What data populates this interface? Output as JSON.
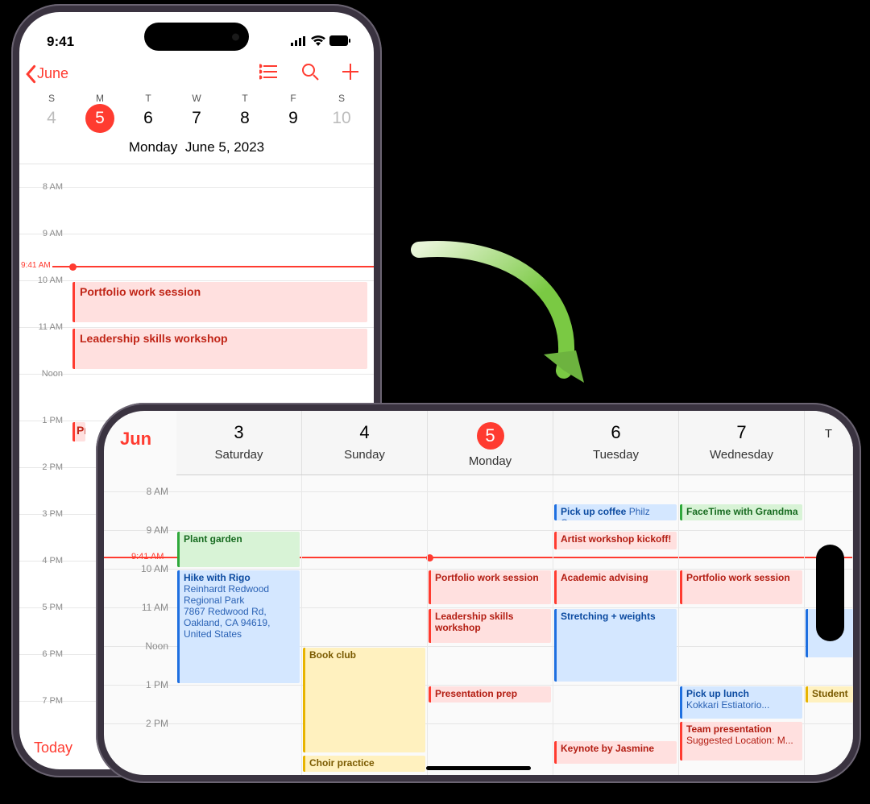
{
  "status": {
    "time": "9:41"
  },
  "portrait": {
    "back_label": "June",
    "dows": [
      "S",
      "M",
      "T",
      "W",
      "T",
      "F",
      "S"
    ],
    "days": [
      "4",
      "5",
      "6",
      "7",
      "8",
      "9",
      "10"
    ],
    "today_index": 1,
    "full_date_day": "Monday",
    "full_date": "June 5, 2023",
    "hours": [
      "8 AM",
      "9 AM",
      "10 AM",
      "11 AM",
      "Noon",
      "1 PM",
      "2 PM",
      "3 PM",
      "4 PM",
      "5 PM",
      "6 PM",
      "7 PM"
    ],
    "now_label": "9:41 AM",
    "events": {
      "e1": "Portfolio work session",
      "e2": "Leadership skills workshop",
      "e3": "Pr"
    },
    "today_button": "Today"
  },
  "landscape": {
    "month": "Jun",
    "cols": [
      {
        "num": "3",
        "name": "Saturday"
      },
      {
        "num": "4",
        "name": "Sunday"
      },
      {
        "num": "5",
        "name": "Monday",
        "today": true
      },
      {
        "num": "6",
        "name": "Tuesday"
      },
      {
        "num": "7",
        "name": "Wednesday"
      },
      {
        "num": "",
        "name": "T"
      }
    ],
    "hours": [
      "8 AM",
      "9 AM",
      "10 AM",
      "11 AM",
      "Noon",
      "1 PM",
      "2 PM"
    ],
    "now_label": "9:41 AM",
    "events": {
      "sat_plant": "Plant garden",
      "sat_hike_t": "Hike with Rigo",
      "sat_hike_loc": "Reinhardt Redwood Regional Park\n7867 Redwood Rd, Oakland, CA 94619, United States",
      "sun_book": "Book club",
      "sun_choir": "Choir practice",
      "mon_portfolio": "Portfolio work session",
      "mon_leadership": "Leadership skills workshop",
      "mon_prep": "Presentation prep",
      "tue_coffee_t": "Pick up coffee",
      "tue_coffee_l": "Philz Co...",
      "tue_artist": "Artist workshop kickoff!",
      "tue_advising": "Academic advising",
      "tue_stretch": "Stretching + weights",
      "tue_keynote": "Keynote by Jasmine",
      "wed_ft": "FaceTime with Grandma",
      "wed_portfolio": "Portfolio work session",
      "wed_lunch_t": "Pick up lunch",
      "wed_lunch_l": "Kokkari Estiatorio...",
      "wed_team_t": "Team presentation",
      "wed_team_l": "Suggested Location: M...",
      "thu_student": "Student"
    }
  }
}
